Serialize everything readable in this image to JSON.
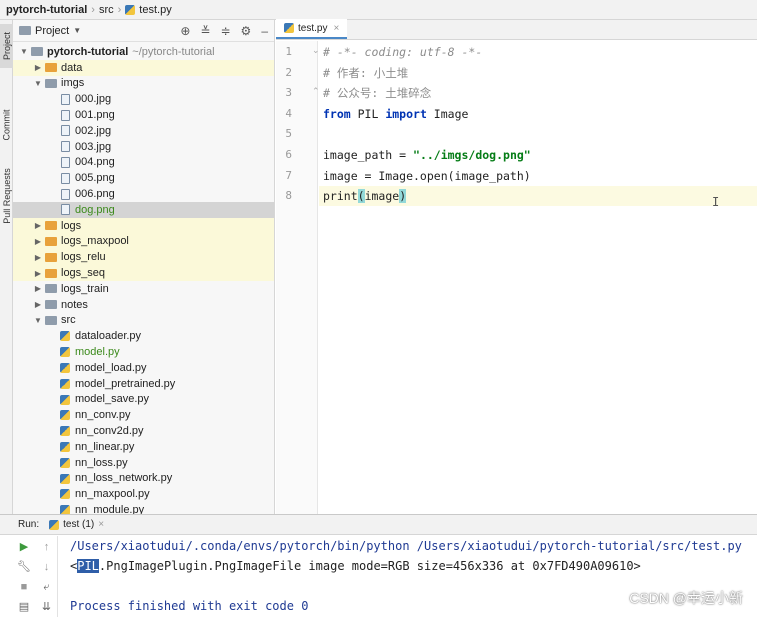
{
  "breadcrumb": {
    "project": "pytorch-tutorial",
    "folder": "src",
    "file": "test.py"
  },
  "left_strip": {
    "tabs": [
      "Project",
      "Commit",
      "Pull Requests"
    ]
  },
  "project_panel": {
    "title": "Project",
    "tools": [
      "target-icon",
      "collapse-icon",
      "expand-icon",
      "gear-icon",
      "minimize-icon"
    ],
    "tree": [
      {
        "label": "pytorch-tutorial",
        "path": "~/pytorch-tutorial",
        "type": "folder",
        "expanded": true,
        "depth": 0,
        "bold": true
      },
      {
        "label": "data",
        "type": "folder-orange",
        "expanded": false,
        "depth": 1,
        "highlight": "yellow"
      },
      {
        "label": "imgs",
        "type": "folder",
        "expanded": true,
        "depth": 1
      },
      {
        "label": "000.jpg",
        "type": "file",
        "depth": 2
      },
      {
        "label": "001.png",
        "type": "file",
        "depth": 2
      },
      {
        "label": "002.jpg",
        "type": "file",
        "depth": 2
      },
      {
        "label": "003.jpg",
        "type": "file",
        "depth": 2
      },
      {
        "label": "004.png",
        "type": "file",
        "depth": 2
      },
      {
        "label": "005.png",
        "type": "file",
        "depth": 2
      },
      {
        "label": "006.png",
        "type": "file",
        "depth": 2
      },
      {
        "label": "dog.png",
        "type": "file",
        "depth": 2,
        "selected": true,
        "green": true
      },
      {
        "label": "logs",
        "type": "folder-orange",
        "expanded": false,
        "depth": 1,
        "highlight": "yellow"
      },
      {
        "label": "logs_maxpool",
        "type": "folder-orange",
        "expanded": false,
        "depth": 1,
        "highlight": "yellow"
      },
      {
        "label": "logs_relu",
        "type": "folder-orange",
        "expanded": false,
        "depth": 1,
        "highlight": "yellow"
      },
      {
        "label": "logs_seq",
        "type": "folder-orange",
        "expanded": false,
        "depth": 1,
        "highlight": "yellow"
      },
      {
        "label": "logs_train",
        "type": "folder",
        "expanded": false,
        "depth": 1
      },
      {
        "label": "notes",
        "type": "folder",
        "expanded": false,
        "depth": 1
      },
      {
        "label": "src",
        "type": "folder",
        "expanded": true,
        "depth": 1
      },
      {
        "label": "dataloader.py",
        "type": "py",
        "depth": 2
      },
      {
        "label": "model.py",
        "type": "py",
        "depth": 2,
        "green": true
      },
      {
        "label": "model_load.py",
        "type": "py",
        "depth": 2
      },
      {
        "label": "model_pretrained.py",
        "type": "py",
        "depth": 2
      },
      {
        "label": "model_save.py",
        "type": "py",
        "depth": 2
      },
      {
        "label": "nn_conv.py",
        "type": "py",
        "depth": 2
      },
      {
        "label": "nn_conv2d.py",
        "type": "py",
        "depth": 2
      },
      {
        "label": "nn_linear.py",
        "type": "py",
        "depth": 2
      },
      {
        "label": "nn_loss.py",
        "type": "py",
        "depth": 2
      },
      {
        "label": "nn_loss_network.py",
        "type": "py",
        "depth": 2
      },
      {
        "label": "nn_maxpool.py",
        "type": "py",
        "depth": 2
      },
      {
        "label": "nn_module.py",
        "type": "py",
        "depth": 2
      }
    ]
  },
  "editor": {
    "tab_label": "test.py",
    "current_line": 8,
    "lines": [
      {
        "num": "1",
        "text": "# -*- coding: utf-8 -*-"
      },
      {
        "num": "2",
        "text": "# 作者: 小土堆"
      },
      {
        "num": "3",
        "text": "# 公众号: 土堆碎念"
      },
      {
        "num": "4",
        "kw1": "from",
        "mid": " PIL ",
        "kw2": "import",
        "rest": " Image"
      },
      {
        "num": "5",
        "text": ""
      },
      {
        "num": "6",
        "pre": "image_path = ",
        "str": "\"../imgs/dog.png\""
      },
      {
        "num": "7",
        "text": "image = Image.open(image_path)"
      },
      {
        "num": "8",
        "pre": "print",
        "paren_open": "(",
        "arg": "image",
        "paren_close": ")"
      }
    ]
  },
  "run_panel": {
    "label": "Run:",
    "tab": "test (1)",
    "console": {
      "command": "/Users/xiaotudui/.conda/envs/pytorch/bin/python /Users/xiaotudui/pytorch-tutorial/src/test.py",
      "out_prefix": "<",
      "out_highlight": "PIL",
      "out_rest": ".PngImagePlugin.PngImageFile image mode=RGB size=456x336 at 0x7FD490A09610>",
      "finished": "Process finished with exit code 0"
    }
  },
  "watermark": "CSDN @幸运小新"
}
